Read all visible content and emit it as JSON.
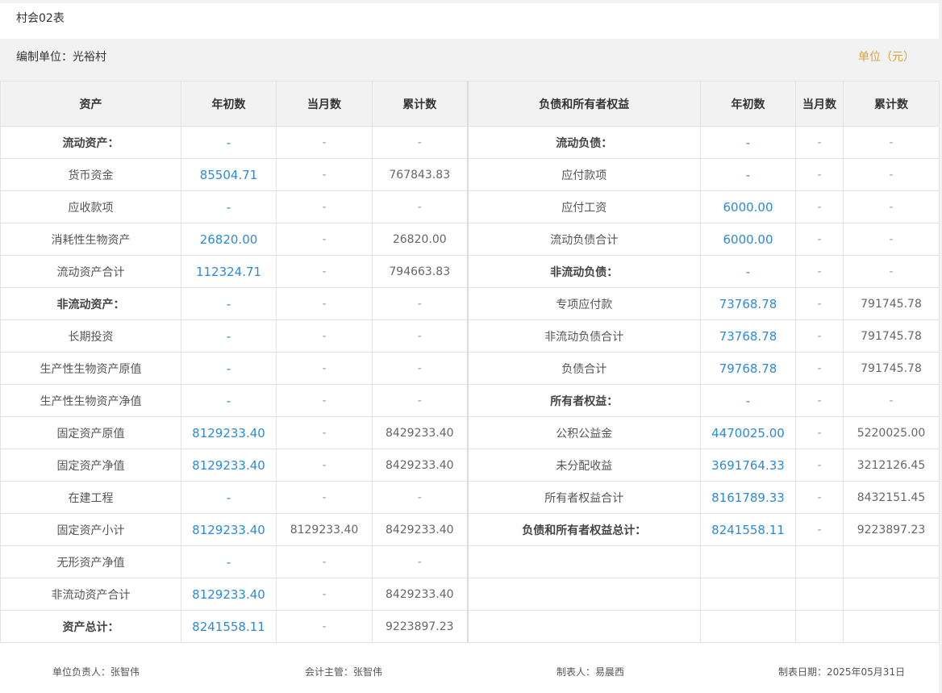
{
  "title": "村会02表",
  "org_label": "编制单位：光裕村",
  "unit_label": "单位（元）",
  "columns": [
    "资产",
    "年初数",
    "当月数",
    "累计数",
    "负债和所有者权益",
    "年初数",
    "当月数",
    "累计数"
  ],
  "rows": [
    {
      "a": "流动资产：",
      "a_bold": true,
      "a1": "-",
      "a2": "-",
      "a3": "-",
      "l": "流动负债：",
      "l_bold": true,
      "l1": "-",
      "l2": "-",
      "l3": "-"
    },
    {
      "a": "货币资金",
      "a1": "85504.71",
      "a2": "-",
      "a3": "767843.83",
      "l": "应付款项",
      "l1": "-",
      "l2": "-",
      "l3": "-"
    },
    {
      "a": "应收款项",
      "a1": "-",
      "a2": "-",
      "a3": "-",
      "l": "应付工资",
      "l1": "6000.00",
      "l2": "-",
      "l3": "-"
    },
    {
      "a": "消耗性生物资产",
      "a1": "26820.00",
      "a2": "-",
      "a3": "26820.00",
      "l": "流动负债合计",
      "l1": "6000.00",
      "l2": "-",
      "l3": "-"
    },
    {
      "a": "流动资产合计",
      "a1": "112324.71",
      "a2": "-",
      "a3": "794663.83",
      "l": "非流动负债：",
      "l_bold": true,
      "l1": "-",
      "l2": "-",
      "l3": "-"
    },
    {
      "a": "非流动资产：",
      "a_bold": true,
      "a1": "-",
      "a2": "-",
      "a3": "-",
      "l": "专项应付款",
      "l1": "73768.78",
      "l2": "-",
      "l3": "791745.78"
    },
    {
      "a": "长期投资",
      "a1": "-",
      "a2": "-",
      "a3": "-",
      "l": "非流动负债合计",
      "l1": "73768.78",
      "l2": "-",
      "l3": "791745.78"
    },
    {
      "a": "生产性生物资产原值",
      "a1": "-",
      "a2": "-",
      "a3": "-",
      "l": "负债合计",
      "l1": "79768.78",
      "l2": "-",
      "l3": "791745.78"
    },
    {
      "a": "生产性生物资产净值",
      "a1": "-",
      "a2": "-",
      "a3": "-",
      "l": "所有者权益：",
      "l_bold": true,
      "l1": "-",
      "l2": "-",
      "l3": "-"
    },
    {
      "a": "固定资产原值",
      "a1": "8129233.40",
      "a2": "-",
      "a3": "8429233.40",
      "l": "公积公益金",
      "l1": "4470025.00",
      "l2": "-",
      "l3": "5220025.00"
    },
    {
      "a": "固定资产净值",
      "a1": "8129233.40",
      "a2": "-",
      "a3": "8429233.40",
      "l": "未分配收益",
      "l1": "3691764.33",
      "l2": "-",
      "l3": "3212126.45"
    },
    {
      "a": "在建工程",
      "a1": "-",
      "a2": "-",
      "a3": "-",
      "l": "所有者权益合计",
      "l1": "8161789.33",
      "l2": "-",
      "l3": "8432151.45"
    },
    {
      "a": "固定资产小计",
      "a1": "8129233.40",
      "a2": "8129233.40",
      "a3": "8429233.40",
      "l": "负债和所有者权益总计：",
      "l_bold": true,
      "l1": "8241558.11",
      "l2": "-",
      "l3": "9223897.23"
    },
    {
      "a": "无形资产净值",
      "a1": "-",
      "a2": "-",
      "a3": "-",
      "l": "",
      "l1": "",
      "l2": "",
      "l3": ""
    },
    {
      "a": "非流动资产合计",
      "a1": "8129233.40",
      "a2": "-",
      "a3": "8429233.40",
      "l": "",
      "l1": "",
      "l2": "",
      "l3": ""
    },
    {
      "a": "资产总计：",
      "a_bold": true,
      "a1": "8241558.11",
      "a2": "-",
      "a3": "9223897.23",
      "l": "",
      "l1": "",
      "l2": "",
      "l3": ""
    }
  ],
  "footer": {
    "unit_head": "单位负责人：张智伟",
    "accountant": "会计主管：张智伟",
    "preparer": "制表人：易晨西",
    "date": "制表日期：2025年05月31日"
  },
  "colors": {
    "accent_blue": "#2c8ad8",
    "unit_gold": "#d9a441",
    "header_bg": "#f2f2f2"
  }
}
